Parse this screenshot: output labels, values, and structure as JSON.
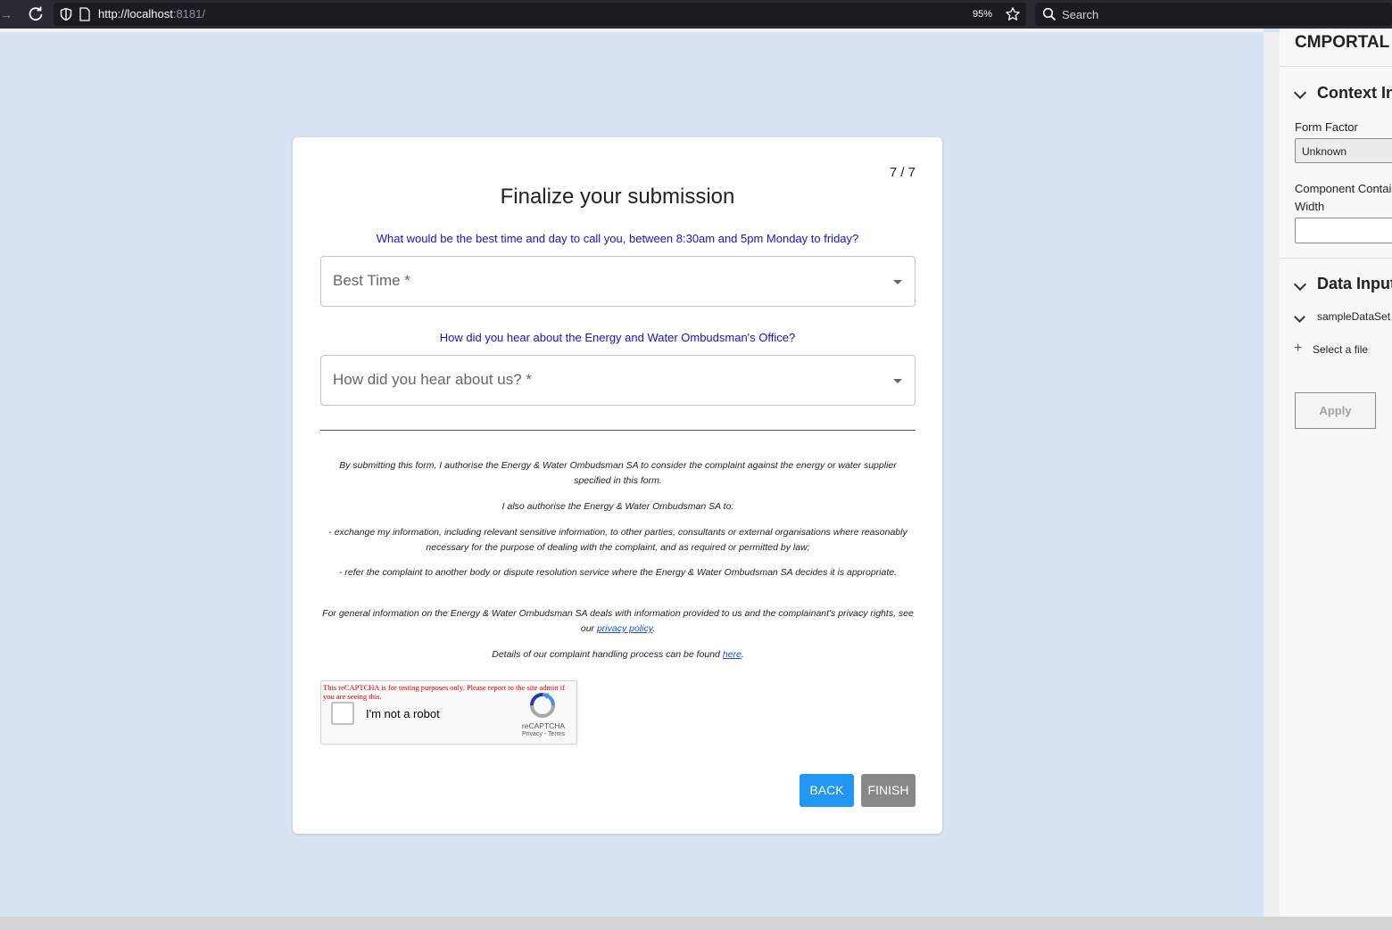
{
  "browser": {
    "url_host": "http://localhost",
    "url_rest": ":8181/",
    "zoom": "95%",
    "search_placeholder": "Search"
  },
  "form": {
    "step": "7 / 7",
    "title": "Finalize your submission",
    "question_time": "What would be the best time and day to call you, between 8:30am and 5pm Monday to friday?",
    "best_time_label": "Best Time *",
    "question_hear": "How did you hear about the Energy and Water Ombudsman's Office?",
    "hear_label": "How did you hear about us? *",
    "legal_1": "By submitting this form, I authorise the Energy & Water Ombudsman SA to consider the complaint against the energy or water supplier specified in this form.",
    "legal_2": "I also authorise the Energy & Water Ombudsman SA to:",
    "legal_3": "- exchange my information, including relevant sensitive information, to other parties, consultants or external organisations where reasonably necessary for the purpose of dealing with the complaint, and as required or permitted by law;",
    "legal_4": "- refer the complaint to another body or dispute resolution service where the Energy & Water Ombudsman SA decides it is appropriate.",
    "legal_5_pre": "For general information on the Energy & Water Ombudsman SA deals with information provided to us and the complainant's privacy rights, see our ",
    "legal_5_link": "privacy policy",
    "legal_5_post": ".",
    "legal_6_pre": "Details of our complaint handling process can be found ",
    "legal_6_link": "here",
    "legal_6_post": ".",
    "captcha_warning": "This reCAPTCHA is for testing purposes only. Please report to the site admin if you are seeing this.",
    "captcha_label": "I'm not a robot",
    "captcha_brand": "reCAPTCHA",
    "captcha_terms": "Privacy - Terms",
    "back_label": "BACK",
    "finish_label": "FINISH"
  },
  "panel": {
    "title": "CMPORTAL",
    "section_context": "Context Inputs",
    "form_factor_label": "Form Factor",
    "form_factor_value": "Unknown",
    "component_label_1": "Component Container",
    "component_label_2": "Width",
    "section_data": "Data Inputs",
    "dataset_label": "sampleDataSet",
    "select_file": "Select a file",
    "apply_label": "Apply"
  },
  "colors": {
    "page_bg": "#d7e3f3",
    "question_text": "#1a12c8",
    "back_button": "#2196f3",
    "finish_button": "#888888",
    "captcha_warning": "#e00000"
  }
}
